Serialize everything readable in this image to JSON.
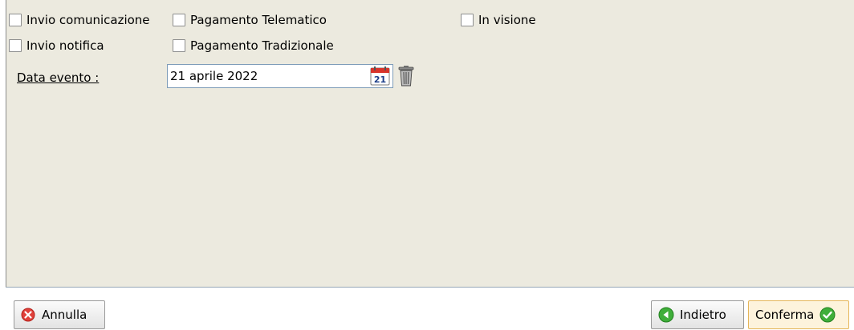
{
  "options": {
    "invio_comunicazione": "Invio comunicazione",
    "pagamento_telematico": "Pagamento Telematico",
    "in_visione": "In visione",
    "invio_notifica": "Invio notifica",
    "pagamento_tradizionale": "Pagamento Tradizionale"
  },
  "date_event": {
    "label": "Data evento :",
    "value": "21 aprile 2022",
    "calendar_day": "21"
  },
  "footer": {
    "cancel_label": "Annulla",
    "back_label": "Indietro",
    "confirm_label": "Conferma"
  },
  "colors": {
    "panel_bg": "#eceadf",
    "cancel_icon": "#e0403a",
    "nav_icon": "#3fae3a"
  }
}
